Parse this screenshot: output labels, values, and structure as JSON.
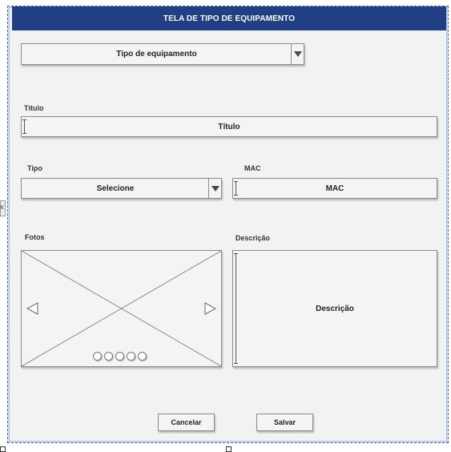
{
  "window": {
    "title": "TELA DE TIPO DE EQUIPAMENTO"
  },
  "equipment_type": {
    "label": "Tipo de equipamento"
  },
  "titulo": {
    "label": "Título",
    "placeholder": "Título"
  },
  "tipo": {
    "label": "Tipo",
    "value": "Selecione"
  },
  "mac": {
    "label": "MAC",
    "placeholder": "MAC"
  },
  "fotos": {
    "label": "Fotos",
    "carousel_dots": 5
  },
  "descricao": {
    "label": "Descrição",
    "placeholder": "Descrição"
  },
  "actions": {
    "cancel_label": "Cancelar",
    "save_label": "Salvar"
  },
  "handles": {
    "left_glyph": "x"
  },
  "colors": {
    "header": "#213f84",
    "frame_border": "#3a5fb0",
    "background": "#f2f2f2"
  },
  "icons": {
    "dropdown": "chevron-down-icon",
    "prev": "arrow-left-icon",
    "next": "arrow-right-icon",
    "image_placeholder": "image-placeholder-icon"
  }
}
